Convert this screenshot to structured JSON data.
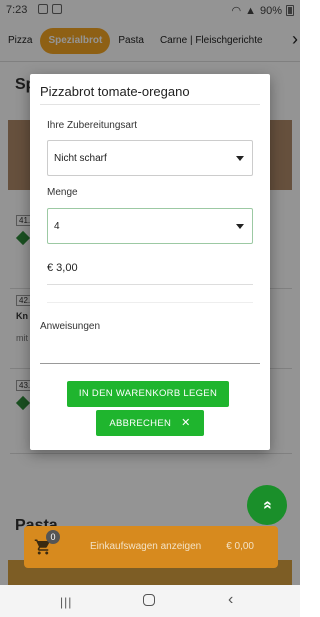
{
  "status_bar": {
    "time": "7:23",
    "battery": "90%"
  },
  "categories": [
    {
      "label": "Pizza",
      "active": false
    },
    {
      "label": "Spezialbrot",
      "active": true
    },
    {
      "label": "Pasta",
      "active": false
    },
    {
      "label": "Carne | Fleischgerichte",
      "active": false
    }
  ],
  "background": {
    "section_title": "Sp",
    "item_numbers": [
      "41.",
      "42.",
      "43."
    ],
    "item_name_partial": "Kn",
    "item_desc_partial": "mit",
    "next_section": "Pasta"
  },
  "modal": {
    "title": "Pizzabrot tomate-oregano",
    "preparation_label": "Ihre Zubereitungsart",
    "preparation_value": "Nicht scharf",
    "quantity_label": "Menge",
    "quantity_value": "4",
    "price": "€ 3,00",
    "notes_label": "Anweisungen",
    "add_to_cart_label": "IN DEN WARENKORB LEGEN",
    "cancel_label": "ABBRECHEN",
    "cancel_icon": "close-icon"
  },
  "cart": {
    "count": "0",
    "label": "Einkaufswagen anzeigen",
    "total": "€ 0,00"
  },
  "colors": {
    "accent": "#f5a623",
    "green": "#1fb52e",
    "cart_bar": "#d78a1e"
  }
}
